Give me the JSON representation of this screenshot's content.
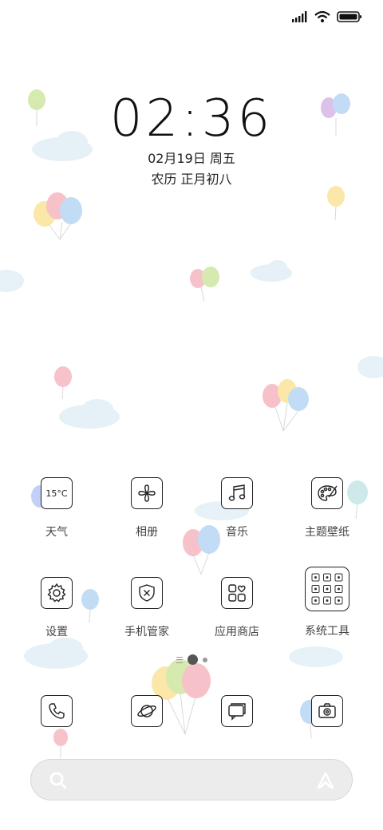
{
  "status_bar": {
    "icons": [
      "signal-icon",
      "wifi-icon",
      "battery-icon"
    ]
  },
  "lock": {
    "time": "02:36",
    "date": "02月19日 周五",
    "lunar": "农历 正月初八"
  },
  "weather_widget": {
    "temperature": "15°C"
  },
  "apps_row1": [
    {
      "label": "天气",
      "icon": "weather-icon"
    },
    {
      "label": "相册",
      "icon": "flower-icon"
    },
    {
      "label": "音乐",
      "icon": "music-note-icon"
    },
    {
      "label": "主题壁纸",
      "icon": "palette-icon"
    }
  ],
  "apps_row2": [
    {
      "label": "设置",
      "icon": "gear-icon"
    },
    {
      "label": "手机管家",
      "icon": "shield-icon"
    },
    {
      "label": "应用商店",
      "icon": "app-store-icon"
    },
    {
      "label": "系统工具",
      "icon": "folder-grid-icon"
    }
  ],
  "dock": [
    {
      "icon": "phone-icon"
    },
    {
      "icon": "planet-icon"
    },
    {
      "icon": "message-icon"
    },
    {
      "icon": "camera-icon"
    }
  ],
  "pager": {
    "pages": 2,
    "current": 1
  },
  "search_bar": {
    "icons": [
      "search-icon",
      "assistant-icon"
    ]
  },
  "colors": {
    "balloon_pink": "#f6b7c1",
    "balloon_blue": "#b9d6f5",
    "balloon_yellow": "#fbe39a",
    "balloon_green": "#cfe7a2",
    "balloon_purple": "#d6b8e6",
    "cloud": "#e6f1f8"
  }
}
